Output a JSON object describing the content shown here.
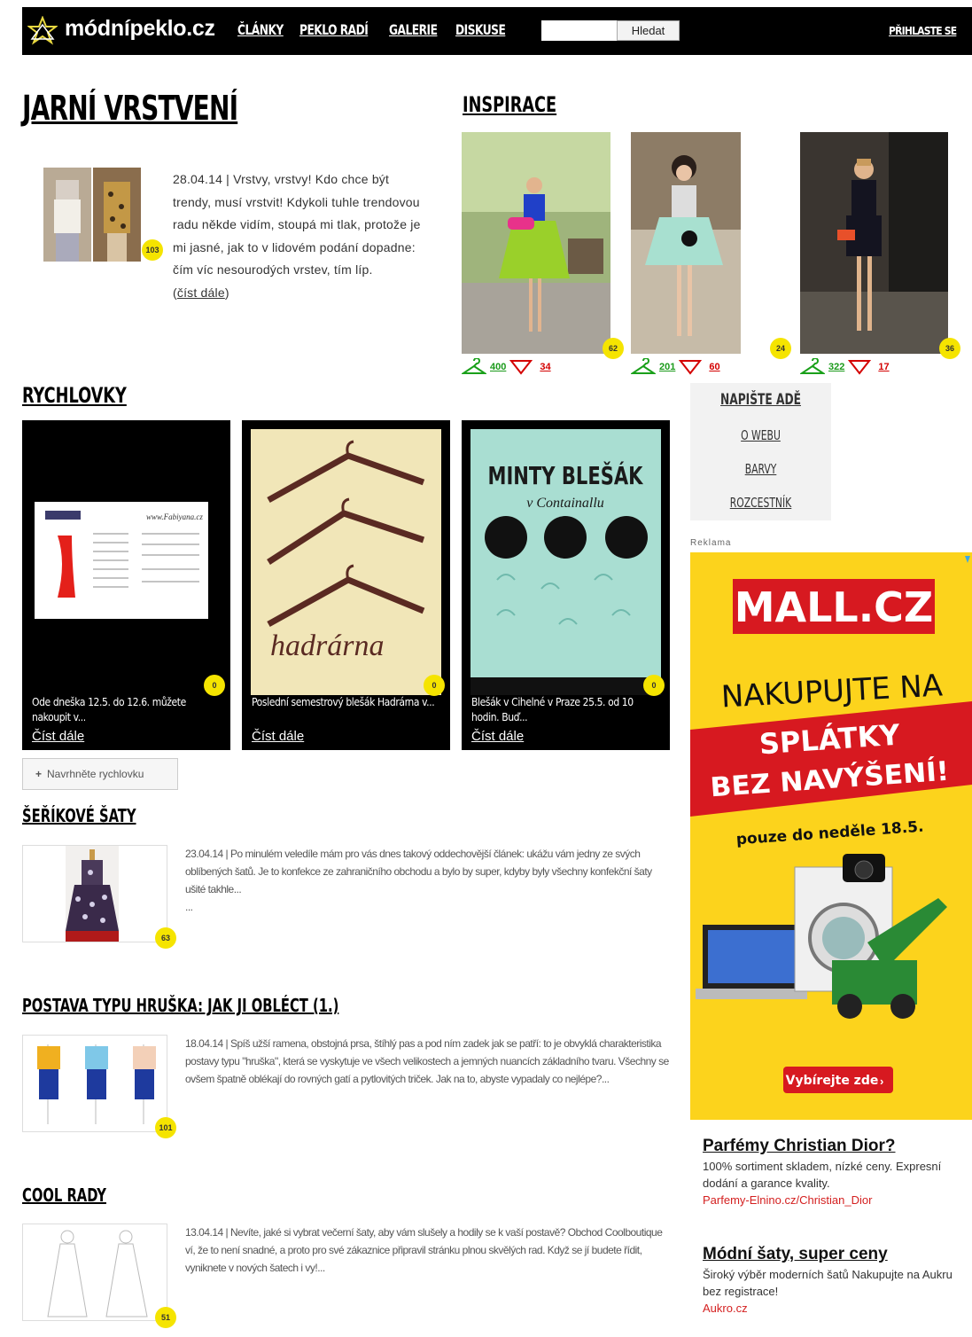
{
  "header": {
    "logo_text": "módnípeklo.cz",
    "nav": [
      "ČLÁNKY",
      "PEKLO RADÍ",
      "GALERIE",
      "DISKUSE"
    ],
    "search_placeholder": "",
    "search_button": "Hledat",
    "login": "PŘIHLASTE SE"
  },
  "hero": {
    "title": "JARNÍ VRSTVENÍ",
    "text": "28.04.14 | Vrstvy, vrstvy! Kdo chce být trendy, musí vrstvit! Kdykoli tuhle trendovou radu někde vidím, stoupá mi tlak, protože je mi jasné, jak to v lidovém podání dopadne: čím víc nesourodých vrstev, tím líp.",
    "read_more_open": "(",
    "read_more": "číst dále",
    "read_more_close": ")",
    "badge": "103"
  },
  "inspiration": {
    "title": "INSPIRACE",
    "items": [
      {
        "badge": "62",
        "likes": "400",
        "hearts": "34"
      },
      {
        "badge": "24",
        "likes": "201",
        "hearts": "60"
      },
      {
        "badge": "36",
        "likes": "322",
        "hearts": "17"
      }
    ]
  },
  "quick": {
    "title": "RYCHLOVKY",
    "items": [
      {
        "caption": "Ode dneška 12.5. do 12.6. můžete nakoupit v...",
        "more": "Číst dále",
        "badge": "0"
      },
      {
        "caption": "Poslední semestrový blešák Hadrárna v...",
        "more": "Číst dále",
        "badge": "0"
      },
      {
        "caption": "Blešák v Cihelné v Praze 25.5. od 10 hodin. Buď...",
        "more": "Číst dále",
        "badge": "0"
      }
    ],
    "poster2_text": "hadrárna",
    "poster3_title": "MINTY BLEŠÁK",
    "poster3_sub": "v Containallu",
    "suggest_button": "Navrhněte rychlovku"
  },
  "sidebar": {
    "links": [
      "NAPIŠTE ADĚ",
      "O WEBU",
      "BARVY",
      "ROZCESTNÍK"
    ],
    "ad_label": "Reklama"
  },
  "ad": {
    "brand": "MALL.CZ",
    "line1": "NAKUPUJTE NA",
    "line2": "SPLÁTKY",
    "line3": "BEZ NAVÝŠENÍ!",
    "line4": "pouze do neděle 18.5.",
    "cta": "Vybírejte zde",
    "accent": "#d71920"
  },
  "articles": [
    {
      "title": "ŠEŘÍKOVÉ ŠATY",
      "text": "23.04.14 | Po minulém veledíle mám pro vás dnes takový oddechovější článek: ukážu vám jedny ze svých oblíbených šatů. Je to konfekce ze zahraničního obchodu a bylo by super, kdyby byly všechny konfekční šaty ušité takhle...",
      "ellipsis": "...",
      "badge": "63"
    },
    {
      "title": "POSTAVA TYPU HRUŠKA: JAK JI OBLÉCT (1.)",
      "text": "18.04.14 | Spíš užší ramena, obstojná prsa, štíhlý pas a pod ním zadek jak se patří: to je obvyklá charakteristika postavy typu \"hruška\", která se vyskytuje ve všech velikostech a jemných nuancích základního tvaru. Všechny se ovšem špatně oblékají do rovných gatí a pytlovitých triček. Jak na to, abyste vypadaly co nejlépe?...",
      "badge": "101"
    },
    {
      "title": "COOL RADY",
      "text": "13.04.14 | Nevíte, jaké si vybrat večerní šaty, aby vám slušely a hodily se k vaší postavě? Obchod Coolboutique ví, že to není snadné, a proto pro své zákaznice připravil stránku plnou skvělých rad. Když se jí budete řídit, vyniknete v nových šatech i vy!...",
      "badge": "51"
    }
  ],
  "text_ads": [
    {
      "title": "Parfémy Christian Dior?",
      "body": "100% sortiment skladem, nízké ceny. Expresní dodání a garance kvality.",
      "url": "Parfemy-Elnino.cz/Christian_Dior"
    },
    {
      "title": "Módní šaty, super ceny",
      "body": "Široký výběr moderních šatů Nakupujte na Aukru bez registrace!",
      "url": "Aukro.cz"
    }
  ]
}
